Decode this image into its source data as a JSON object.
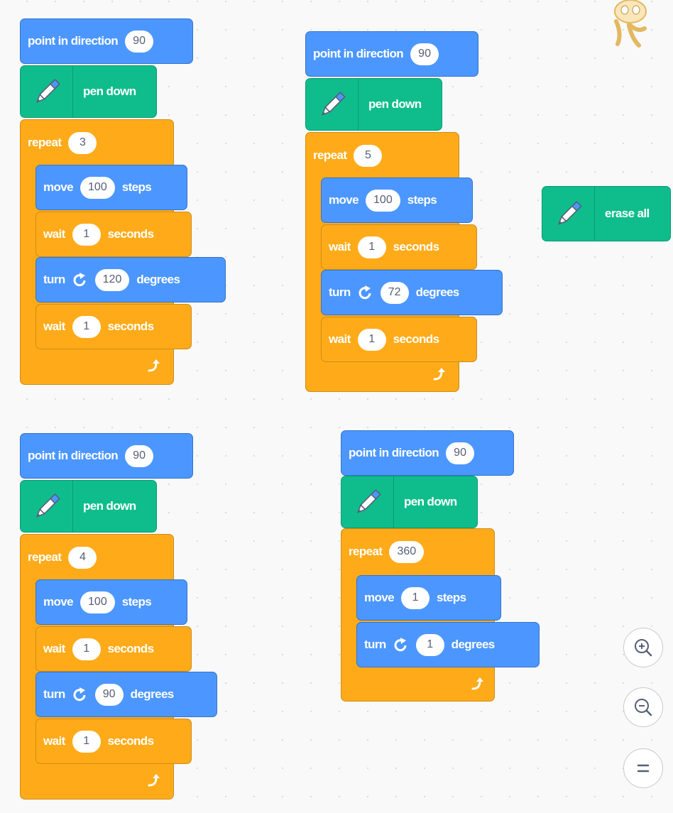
{
  "blocks": {
    "point_in_direction": "point in direction",
    "pen_down": "pen down",
    "repeat": "repeat",
    "move": "move",
    "steps": "steps",
    "wait": "wait",
    "seconds": "seconds",
    "turn": "turn",
    "degrees": "degrees",
    "erase_all": "erase all"
  },
  "scripts": {
    "triangle": {
      "direction": "90",
      "repeat": "3",
      "move": "100",
      "wait1": "1",
      "turn": "120",
      "wait2": "1"
    },
    "pentagon": {
      "direction": "90",
      "repeat": "5",
      "move": "100",
      "wait1": "1",
      "turn": "72",
      "wait2": "1"
    },
    "square": {
      "direction": "90",
      "repeat": "4",
      "move": "100",
      "wait1": "1",
      "turn": "90",
      "wait2": "1"
    },
    "circle": {
      "direction": "90",
      "repeat": "360",
      "move": "1",
      "turn": "1"
    }
  },
  "colors": {
    "motion": "#4c97ff",
    "pen": "#0fbd8c",
    "control": "#ffab19",
    "canvas": "#f9f9f9"
  },
  "icons": {
    "pen": "pen-icon",
    "turn_right": "rotate-right-icon",
    "loop": "loop-arrow-icon",
    "zoom_in": "zoom-in-icon",
    "zoom_out": "zoom-out-icon",
    "zoom_reset": "zoom-reset-icon",
    "sprite": "cat-sprite-icon"
  }
}
